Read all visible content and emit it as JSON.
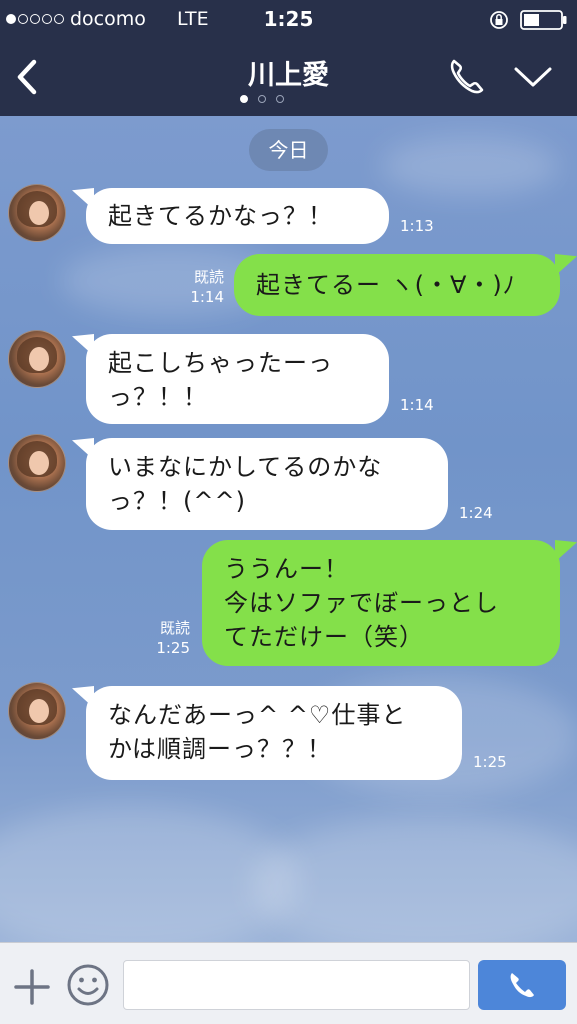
{
  "status_bar": {
    "carrier": "docomo",
    "network": "LTE",
    "time": "1:25",
    "signal_icon": "signal-dots-icon",
    "lock_icon": "rotation-lock-icon",
    "battery_icon": "battery-icon"
  },
  "nav": {
    "title": "川上愛",
    "back_icon": "chevron-left-icon",
    "call_icon": "phone-icon",
    "dropdown_icon": "chevron-down-icon"
  },
  "chat": {
    "date_label": "今日",
    "messages": [
      {
        "side": "in",
        "text": "起きてるかなっ？！",
        "time": "1:13"
      },
      {
        "side": "out",
        "text": "起きてるー ヽ(・∀・)ﾉ",
        "read": "既読",
        "time": "1:14"
      },
      {
        "side": "in",
        "text": "起こしちゃったーっ\nっ？！！",
        "time": "1:14"
      },
      {
        "side": "in",
        "text": "いまなにかしてるのかな\nっ？！(^^)",
        "time": "1:24"
      },
      {
        "side": "out",
        "text": "ううんー！\n今はソファでぼーっとし\nてただけー（笑）",
        "read": "既読",
        "time": "1:25"
      },
      {
        "side": "in",
        "text": "なんだあーっ^ ^♡仕事と\nかは順調ーっ？？！",
        "time": "1:25"
      }
    ]
  },
  "input_bar": {
    "plus_icon": "plus-icon",
    "emoji_icon": "smiley-icon",
    "input_value": "",
    "input_placeholder": "",
    "send_icon": "phone-icon"
  },
  "colors": {
    "nav_bg": "#28304a",
    "incoming_bubble": "#ffffff",
    "outgoing_bubble": "#84e04a",
    "send_button": "#4d86d9"
  }
}
